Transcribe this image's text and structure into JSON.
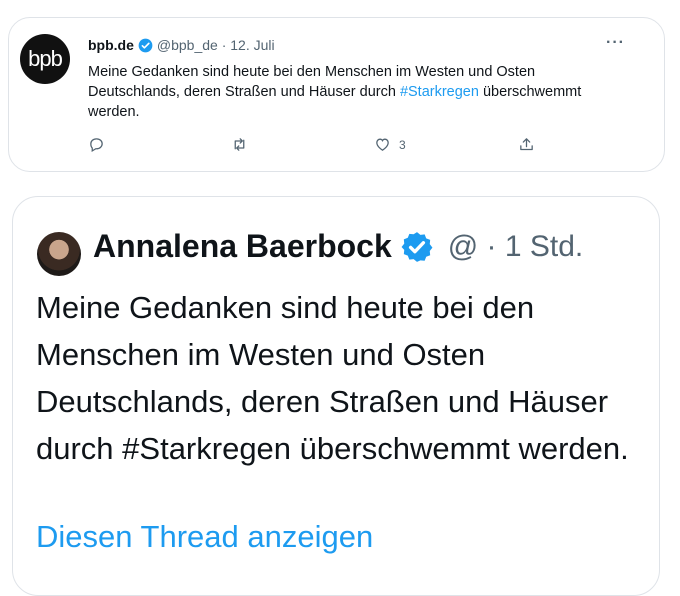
{
  "tweet1": {
    "avatar_text": "bpb",
    "name": "bpb.de",
    "handle_date": "@bpb_de · 12. Juli",
    "more": "···",
    "text_before": "Meine Gedanken sind heute bei den Menschen im Westen und Osten Deutschlands, deren Straßen und Häuser durch ",
    "hashtag": "#Starkregen",
    "text_after": " überschwemmt werden.",
    "like_count": "3"
  },
  "tweet2": {
    "name": "Annalena Baerbock",
    "handle_time": "@ · 1 Std.",
    "text": "Meine Gedanken sind heute bei den Menschen im Westen und Osten Deutschlands, deren Straßen und Häuser durch #Starkregen überschwemmt werden.",
    "thread_link": "Diesen Thread anzeigen"
  },
  "colors": {
    "accent": "#1d9bf0",
    "secondary_text": "#536471",
    "border": "#dfe3e8"
  },
  "icons": [
    "verified-badge-icon",
    "reply-icon",
    "retweet-icon",
    "like-icon",
    "share-icon",
    "more-icon"
  ]
}
